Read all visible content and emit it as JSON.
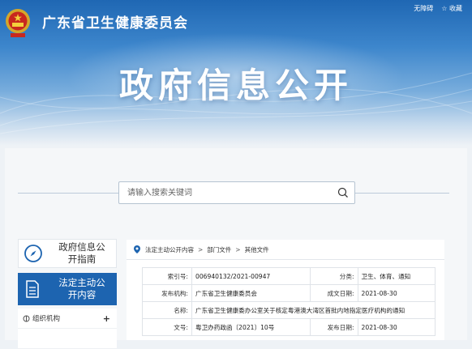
{
  "header": {
    "site_title": "广东省卫生健康委员会",
    "links": {
      "accessibility": "无障碍",
      "favorite": "☆ 收藏"
    },
    "banner_title": "政府信息公开"
  },
  "search": {
    "placeholder": "请输入搜索关键词"
  },
  "sidebar": {
    "guide": "政府信息公开指南",
    "active": "法定主动公开内容",
    "menu": [
      {
        "label": "组织机构",
        "toggle": "+"
      },
      {
        "label": "",
        "toggle": ""
      }
    ]
  },
  "breadcrumb": [
    "法定主动公开内容",
    "部门文件",
    "其他文件"
  ],
  "meta": {
    "index_no_label": "索引号:",
    "index_no": "006940132/2021-00947",
    "category_label": "分类:",
    "category": "卫生、体育、通知",
    "publisher_label": "发布机构:",
    "publisher": "广东省卫生健康委员会",
    "created_label": "成文日期:",
    "created": "2021-08-30",
    "name_label": "名称:",
    "name": "广东省卫生健康委办公室关于核定粤港澳大湾区首批内地指定医疗机构的通知",
    "doc_no_label": "文号:",
    "doc_no": "粤卫办药政函〔2021〕10号",
    "published_label": "发布日期:",
    "published": "2021-08-30"
  },
  "colors": {
    "brand_blue": "#1d64b0",
    "hero_top": "#1f67b3"
  }
}
